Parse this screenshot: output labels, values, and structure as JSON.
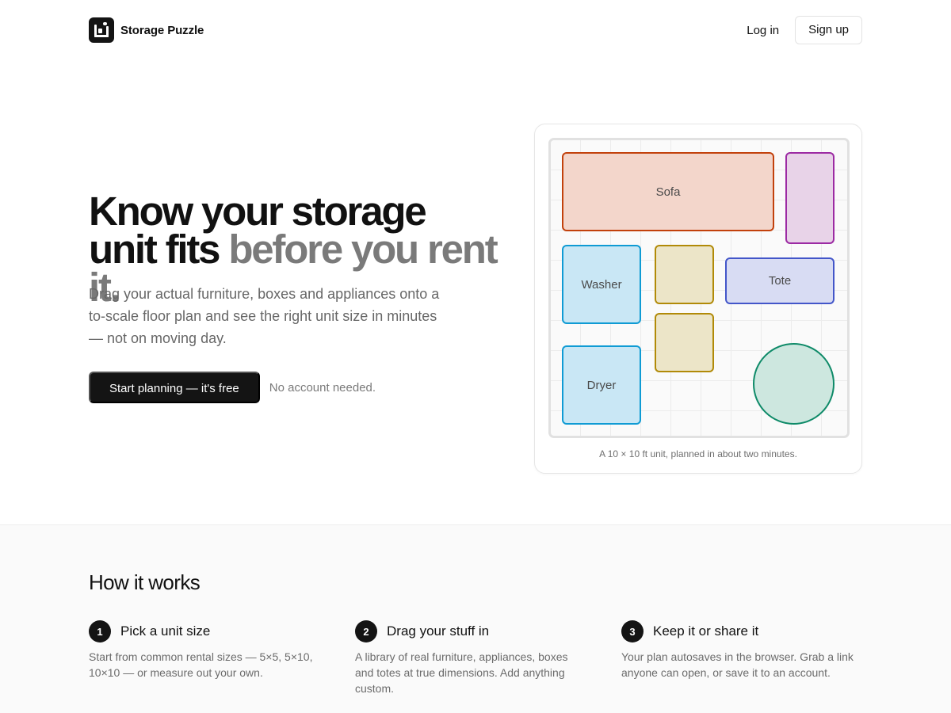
{
  "brand": {
    "name": "Storage Puzzle",
    "logo_icon": "storage-puzzle-logo-icon"
  },
  "nav": {
    "login_label": "Log in",
    "signup_label": "Sign up"
  },
  "hero": {
    "title_main": "Know your storage unit fits",
    "title_muted": "before you rent it.",
    "subtitle": "Drag your actual furniture, boxes and appliances onto a to-scale floor plan and see the right unit size in minutes — not on moving day.",
    "cta_label": "Start planning — it's free",
    "cta_note": "No account needed."
  },
  "floor_plan": {
    "caption": "A 10 × 10 ft unit, planned in about two minutes.",
    "items": [
      {
        "label": "Sofa",
        "border": "#c2410c",
        "fill": "#f3d6cb"
      },
      {
        "label": "",
        "border": "#9c2aa3",
        "fill": "#e8d3e8"
      },
      {
        "label": "Washer",
        "border": "#0f9bd4",
        "fill": "#c9e7f5"
      },
      {
        "label": "",
        "border": "#b18a08",
        "fill": "#ece5c8"
      },
      {
        "label": "Tote",
        "border": "#4356c9",
        "fill": "#d8dcf3"
      },
      {
        "label": "",
        "border": "#b18a08",
        "fill": "#ece5c8"
      },
      {
        "label": "Dryer",
        "border": "#0f9bd4",
        "fill": "#c9e7f5"
      },
      {
        "label": "",
        "border": "#0e8a68",
        "fill": "#cde7df"
      }
    ]
  },
  "how_it_works": {
    "title": "How it works",
    "steps": [
      {
        "number": "1",
        "title": "Pick a unit size",
        "desc": "Start from common rental sizes — 5×5, 5×10, 10×10 — or measure out your own."
      },
      {
        "number": "2",
        "title": "Drag your stuff in",
        "desc": "A library of real furniture, appliances, boxes and totes at true dimensions. Add anything custom."
      },
      {
        "number": "3",
        "title": "Keep it or share it",
        "desc": "Your plan autosaves in the browser. Grab a link anyone can open, or save it to an account."
      }
    ]
  }
}
